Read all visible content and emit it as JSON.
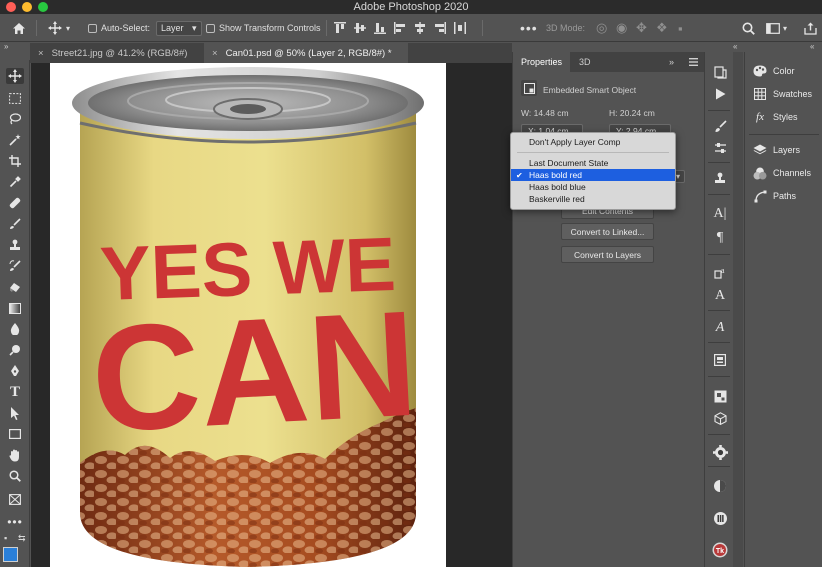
{
  "app": {
    "title": "Adobe Photoshop 2020"
  },
  "options_bar": {
    "auto_select_label": "Auto-Select:",
    "auto_select_value": "Layer",
    "transform_controls_label": "Show Transform Controls",
    "three_d_mode_label": "3D Mode:"
  },
  "document_tabs": [
    {
      "label": "Street21.jpg @ 41.2% (RGB/8#)"
    },
    {
      "label": "Can01.psd @ 50% (Layer 2, RGB/8#) *"
    }
  ],
  "canvas": {
    "can_text_line1": "YES WE",
    "can_text_line2": "CAN",
    "can_label_color": "#e3d27a",
    "can_text_color": "#cc3535"
  },
  "properties": {
    "tabs": [
      "Properties",
      "3D"
    ],
    "object_type": "Embedded Smart Object",
    "width": "W: 14.48 cm",
    "height": "H: 20.24 cm",
    "x": "X: 1.04 cm",
    "y": "Y: 2.94 cm",
    "buttons": [
      "Edit Contents",
      "Convert to Linked...",
      "Convert to Layers"
    ]
  },
  "layer_comp_dropdown": {
    "items": [
      {
        "label": "Don't Apply Layer Comp",
        "selected": false
      },
      {
        "label": "Last Document State",
        "selected": false
      },
      {
        "label": "Haas bold red",
        "selected": true
      },
      {
        "label": "Haas bold blue",
        "selected": false
      },
      {
        "label": "Baskerville red",
        "selected": false
      }
    ]
  },
  "right_panels": {
    "items": [
      {
        "label": "Color",
        "icon": "color-palette-icon"
      },
      {
        "label": "Swatches",
        "icon": "swatches-grid-icon"
      },
      {
        "label": "Styles",
        "icon": "styles-fx-icon"
      },
      {
        "label": "Layers",
        "icon": "layers-stack-icon"
      },
      {
        "label": "Channels",
        "icon": "channels-icon"
      },
      {
        "label": "Paths",
        "icon": "paths-icon"
      }
    ]
  },
  "colors": {
    "foreground": "#2a7fd8",
    "selection": "#1d5fe0"
  }
}
